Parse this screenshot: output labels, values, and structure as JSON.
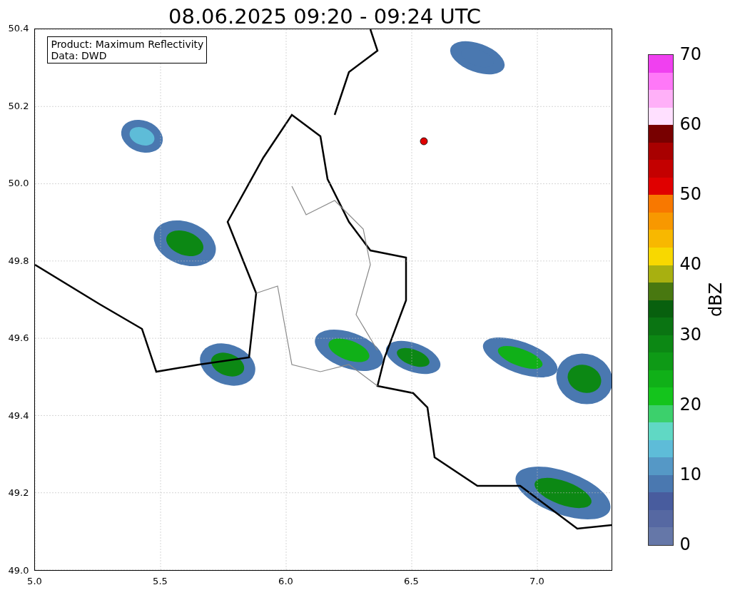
{
  "title": "08.06.2025 09:20 - 09:24 UTC",
  "info_box": [
    "Product: Maximum Reflectivity",
    "Data: DWD"
  ],
  "map": {
    "y_ticks": [
      "50.4",
      "50.2",
      "50.0",
      "49.8",
      "49.6",
      "49.4",
      "49.2",
      "49.0"
    ],
    "x_ticks": [
      "5.0",
      "5.5",
      "6.0",
      "6.5",
      "7.0"
    ]
  },
  "colorbar": {
    "label": "dBZ",
    "ticks": [
      "70",
      "60",
      "50",
      "40",
      "30",
      "20",
      "10",
      "0"
    ],
    "segments": [
      {
        "color": "#6577a8"
      },
      {
        "color": "#5668a2"
      },
      {
        "color": "#485c9e"
      },
      {
        "color": "#4a78b0"
      },
      {
        "color": "#5598c6"
      },
      {
        "color": "#5ebcd8"
      },
      {
        "color": "#60d8c4"
      },
      {
        "color": "#3cd06c"
      },
      {
        "color": "#14c41c"
      },
      {
        "color": "#10b018"
      },
      {
        "color": "#0e9a16"
      },
      {
        "color": "#0c8814"
      },
      {
        "color": "#0a7412"
      },
      {
        "color": "#08600e"
      },
      {
        "color": "#487810"
      },
      {
        "color": "#a8b010"
      },
      {
        "color": "#f8d800"
      },
      {
        "color": "#f8b800"
      },
      {
        "color": "#f89800"
      },
      {
        "color": "#f87800"
      },
      {
        "color": "#e00000"
      },
      {
        "color": "#c40000"
      },
      {
        "color": "#a80000"
      },
      {
        "color": "#780000"
      },
      {
        "color": "#ffe0ff"
      },
      {
        "color": "#ffb0f8"
      },
      {
        "color": "#ff78f8"
      },
      {
        "color": "#f040f0"
      }
    ]
  }
}
